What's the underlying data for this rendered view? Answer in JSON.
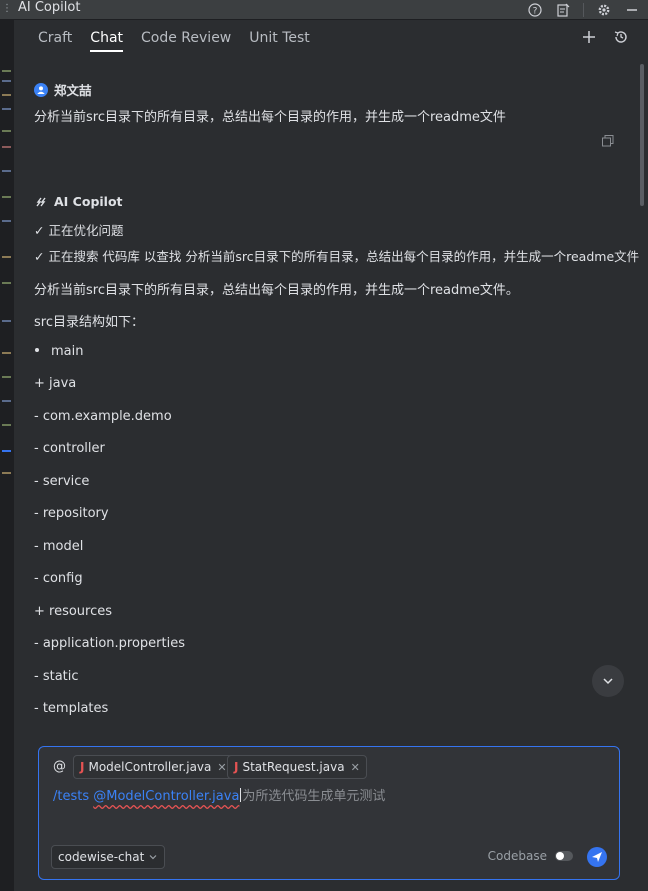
{
  "window": {
    "title": "AI Copilot"
  },
  "tabs": [
    {
      "label": "Craft"
    },
    {
      "label": "Chat",
      "active": true
    },
    {
      "label": "Code Review"
    },
    {
      "label": "Unit Test"
    }
  ],
  "user_message": {
    "author": "郑文喆",
    "text": "分析当前src目录下的所有目录，总结出每个目录的作用，并生成一个readme文件"
  },
  "ai_message": {
    "author": "AI Copilot",
    "steps": [
      "✓ 正在优化问题",
      "✓ 正在搜索 代码库 以查找 分析当前src目录下的所有目录，总结出每个目录的作用，并生成一个readme文件"
    ],
    "intro": "分析当前src目录下的所有目录，总结出每个目录的作用，并生成一个readme文件。",
    "structure_title": "src目录结构如下：",
    "bullet": "main",
    "lines": [
      "+ java",
      "- com.example.demo",
      "- controller",
      "- service",
      "- repository",
      "- model",
      "- config",
      "+ resources",
      "- application.properties",
      "- static",
      "- templates"
    ]
  },
  "input": {
    "at_symbol": "@",
    "chips": [
      {
        "label": "ModelController.java",
        "icon": "java-icon"
      },
      {
        "label": "StatRequest.java",
        "icon": "java-icon"
      }
    ],
    "command": "/tests",
    "mention": "@ModelController.java",
    "placeholder": "为所选代码生成单元测试",
    "model": "codewise-chat",
    "codebase_label": "Codebase",
    "codebase_enabled": false
  },
  "colors": {
    "accent": "#3574f0",
    "background": "#2b2d30",
    "link": "#3b82f6",
    "java_icon": "#e55353"
  }
}
